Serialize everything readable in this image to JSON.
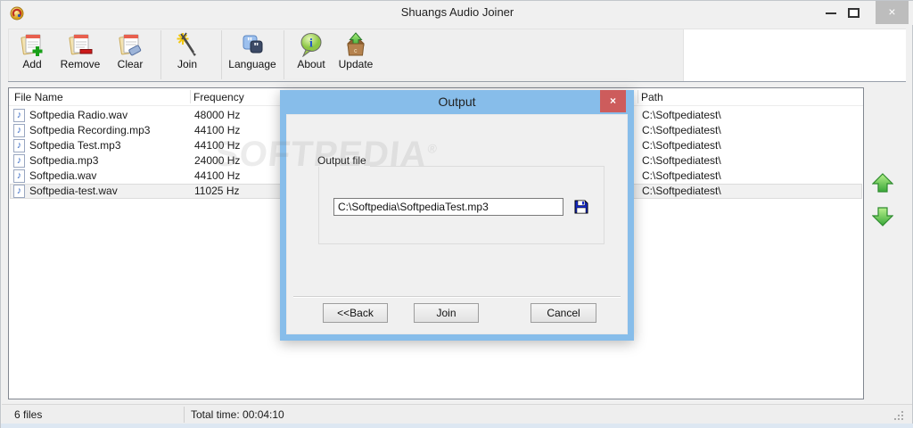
{
  "window": {
    "title": "Shuangs Audio Joiner",
    "close_glyph": "×"
  },
  "toolbar": {
    "items": [
      {
        "label": "Add",
        "icon": "document-add-icon"
      },
      {
        "label": "Remove",
        "icon": "document-remove-icon"
      },
      {
        "label": "Clear",
        "icon": "document-clear-icon"
      },
      {
        "label": "Join",
        "icon": "join-tool-icon"
      },
      {
        "label": "Language",
        "icon": "language-icon"
      },
      {
        "label": "About",
        "icon": "about-balloon-icon"
      },
      {
        "label": "Update",
        "icon": "update-box-icon"
      }
    ]
  },
  "list": {
    "columns": {
      "file_name": "File Name",
      "frequency": "Frequency",
      "path": "Path"
    },
    "rows": [
      {
        "name": "Softpedia Radio.wav",
        "frequency": "48000 Hz",
        "path": "C:\\Softpediatest\\",
        "selected": false
      },
      {
        "name": "Softpedia Recording.mp3",
        "frequency": "44100 Hz",
        "path": "C:\\Softpediatest\\",
        "selected": false
      },
      {
        "name": "Softpedia Test.mp3",
        "frequency": "44100 Hz",
        "path": "C:\\Softpediatest\\",
        "selected": false
      },
      {
        "name": "Softpedia.mp3",
        "frequency": "24000 Hz",
        "path": "C:\\Softpediatest\\",
        "selected": false
      },
      {
        "name": "Softpedia.wav",
        "frequency": "44100 Hz",
        "path": "C:\\Softpediatest\\",
        "selected": false
      },
      {
        "name": "Softpedia-test.wav",
        "frequency": "11025 Hz",
        "path": "C:\\Softpediatest\\",
        "selected": true
      }
    ]
  },
  "dialog": {
    "title": "Output",
    "close_glyph": "×",
    "group_label": "Output file",
    "output_file": "C:\\Softpedia\\SoftpediaTest.mp3",
    "back_label": "<<Back",
    "join_label": "Join",
    "cancel_label": "Cancel"
  },
  "status": {
    "file_count": "6 files",
    "total_time": "Total time: 00:04:10"
  },
  "watermark": "SOFTPEDIA",
  "colors": {
    "dialog_blue": "#87bdea",
    "dialog_close_red": "#cd5c5c",
    "arrow_green": "#3fae3f",
    "note_blue": "#3f6fc8",
    "window_bg": "#f0f0f0",
    "toolbar_line": "#99a0ab"
  }
}
